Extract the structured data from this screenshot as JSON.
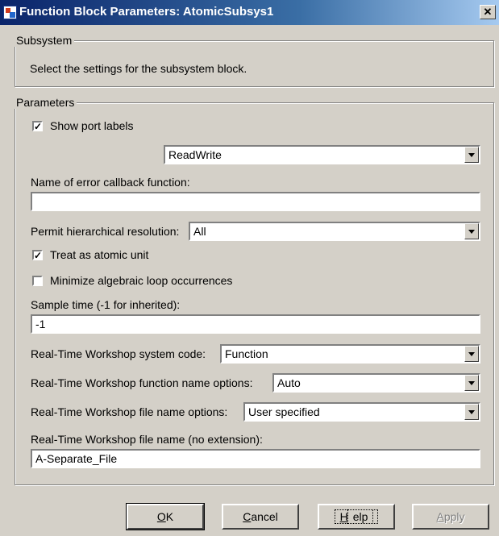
{
  "window": {
    "title": "Function Block Parameters: AtomicSubsys1",
    "close_glyph": "✕"
  },
  "subsystem": {
    "legend": "Subsystem",
    "description": "Select the settings for the subsystem block."
  },
  "parameters": {
    "legend": "Parameters",
    "show_port_labels": {
      "label": "Show port labels",
      "checked": true
    },
    "read_write_select": "ReadWrite",
    "error_callback": {
      "label": "Name of error callback function:",
      "value": ""
    },
    "hierarchical_resolution": {
      "label": "Permit hierarchical resolution:",
      "value": "All"
    },
    "treat_atomic": {
      "label": "Treat as atomic unit",
      "checked": true
    },
    "minimize_loops": {
      "label": "Minimize algebraic loop occurrences",
      "checked": false
    },
    "sample_time": {
      "label": "Sample time (-1 for inherited):",
      "value": "-1"
    },
    "rtw_system_code": {
      "label": "Real-Time Workshop system code:",
      "value": "Function"
    },
    "rtw_function_name": {
      "label": "Real-Time Workshop function name options:",
      "value": "Auto"
    },
    "rtw_file_name_options": {
      "label": "Real-Time Workshop file name options:",
      "value": "User specified"
    },
    "rtw_file_name": {
      "label": "Real-Time Workshop file name (no extension):",
      "value": "A-Separate_File"
    }
  },
  "buttons": {
    "ok": {
      "label": "OK",
      "mnemonic": "O",
      "rest": "K"
    },
    "cancel": {
      "label": "Cancel",
      "mnemonic": "C",
      "rest": "ancel"
    },
    "help": {
      "label": "Help",
      "mnemonic": "H",
      "rest": "elp"
    },
    "apply": {
      "label": "Apply",
      "mnemonic": "A",
      "rest": "pply",
      "enabled": false
    }
  },
  "icons": [
    "simulink-block-icon",
    "close-icon",
    "check-icon",
    "chevron-down-icon"
  ]
}
